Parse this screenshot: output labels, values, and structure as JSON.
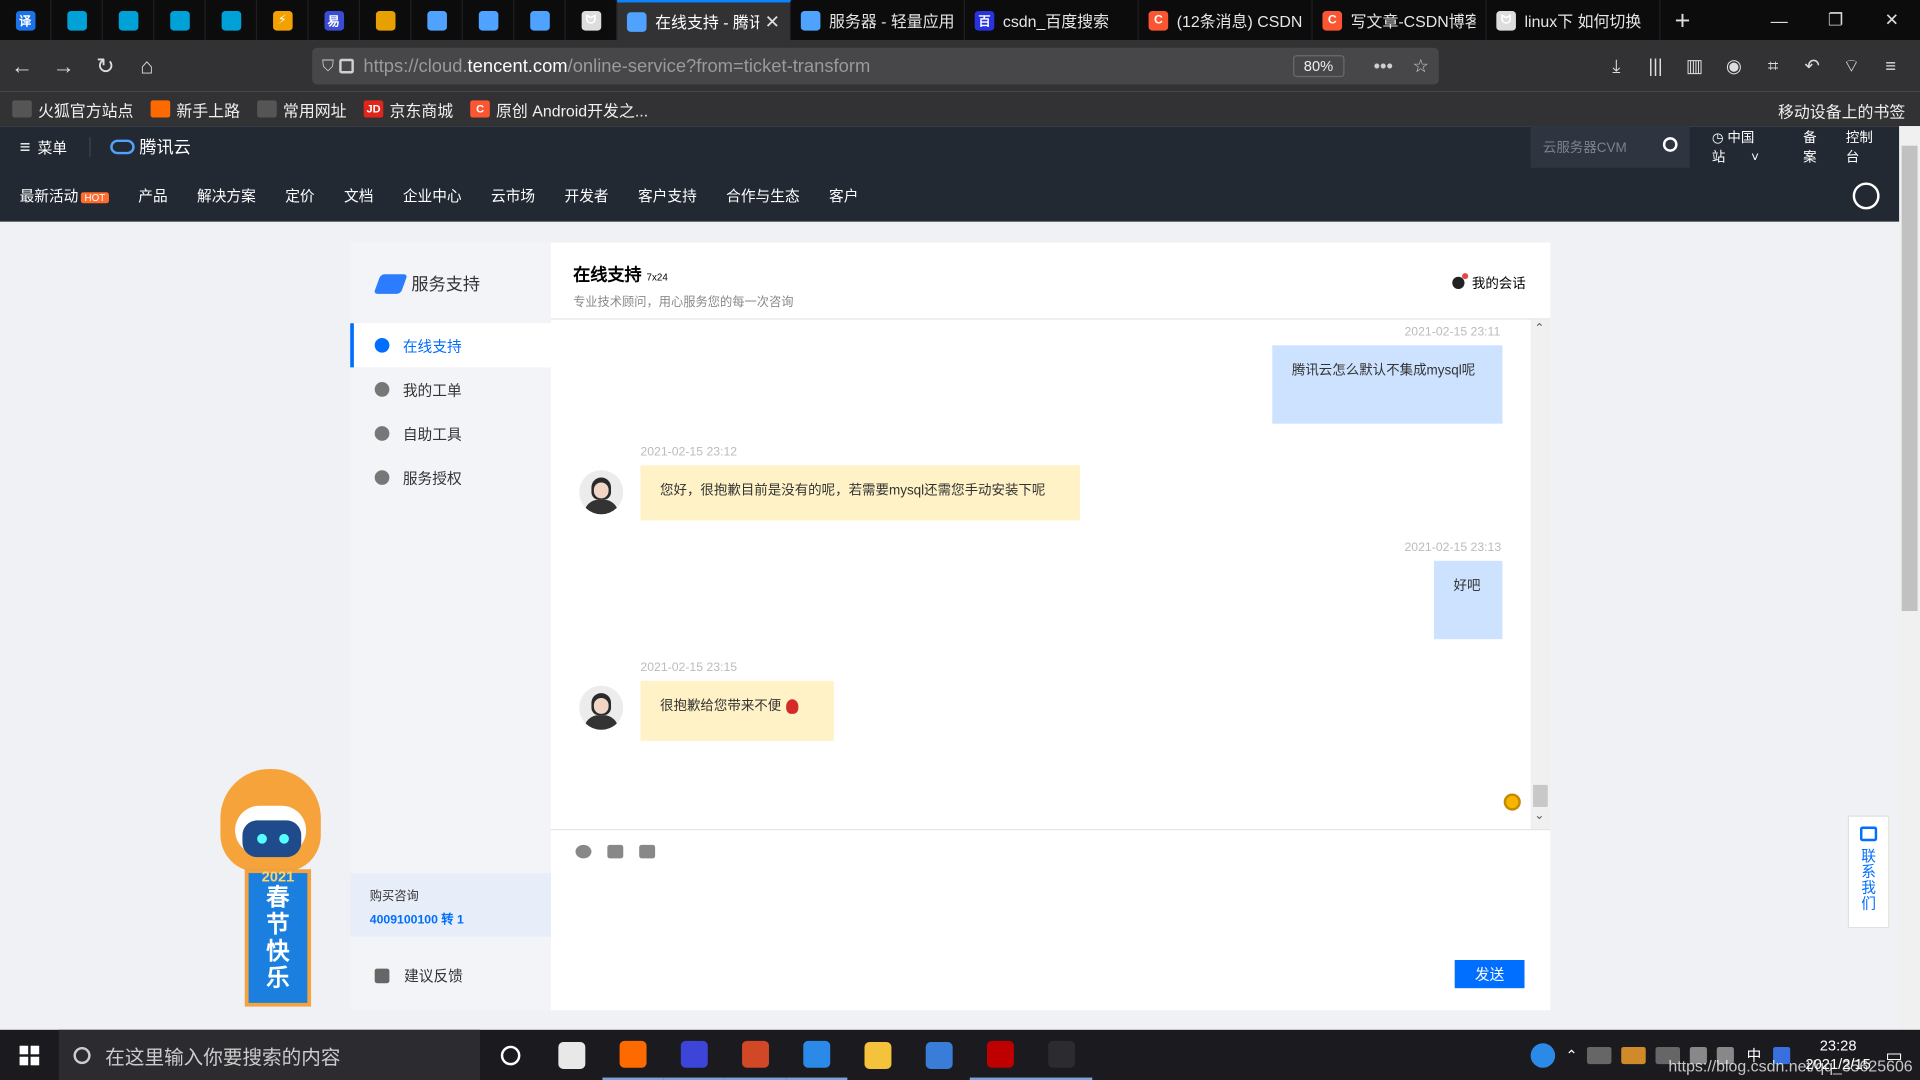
{
  "browser": {
    "tabs": [
      {
        "label": "",
        "icon": "translate-icon",
        "color": "#1a73e8",
        "pinned": true,
        "glyph": "译"
      },
      {
        "label": "",
        "icon": "bilibili-icon",
        "color": "#00a1d6",
        "pinned": true,
        "glyph": ""
      },
      {
        "label": "",
        "icon": "bilibili-icon",
        "color": "#00a1d6",
        "pinned": true,
        "glyph": ""
      },
      {
        "label": "",
        "icon": "bilibili-icon",
        "color": "#00a1d6",
        "pinned": true,
        "glyph": ""
      },
      {
        "label": "",
        "icon": "bilibili-icon",
        "color": "#00a1d6",
        "pinned": true,
        "glyph": ""
      },
      {
        "label": "",
        "icon": "lightning-icon",
        "color": "#f2a100",
        "pinned": true,
        "glyph": "⚡"
      },
      {
        "label": "",
        "icon": "app-icon",
        "color": "#3a4bd8",
        "pinned": true,
        "glyph": "易"
      },
      {
        "label": "",
        "icon": "box-icon",
        "color": "#e6a100",
        "pinned": true,
        "glyph": ""
      },
      {
        "label": "",
        "icon": "tencent-cloud-icon",
        "color": "#4fa3ff",
        "pinned": true,
        "glyph": ""
      },
      {
        "label": "",
        "icon": "tencent-cloud-icon",
        "color": "#4fa3ff",
        "pinned": true,
        "glyph": ""
      },
      {
        "label": "",
        "icon": "tencent-cloud-icon",
        "color": "#4fa3ff",
        "pinned": true,
        "glyph": ""
      },
      {
        "label": "",
        "icon": "wolf-icon",
        "color": "#dddddd",
        "pinned": true,
        "glyph": "ᗢ"
      },
      {
        "label": "在线支持 - 腾讯",
        "icon": "tencent-cloud-icon",
        "color": "#4fa3ff",
        "pinned": false,
        "active": true,
        "glyph": ""
      },
      {
        "label": "服务器 - 轻量应用",
        "icon": "tencent-cloud-icon",
        "color": "#4fa3ff",
        "pinned": false,
        "glyph": ""
      },
      {
        "label": "csdn_百度搜索",
        "icon": "baidu-icon",
        "color": "#2932e1",
        "pinned": false,
        "glyph": "百"
      },
      {
        "label": "(12条消息) CSDN",
        "icon": "csdn-icon",
        "color": "#fc5531",
        "pinned": false,
        "glyph": "C"
      },
      {
        "label": "写文章-CSDN博客",
        "icon": "csdn-icon",
        "color": "#fc5531",
        "pinned": false,
        "glyph": "C"
      },
      {
        "label": "linux下 如何切换",
        "icon": "wolf-icon",
        "color": "#dddddd",
        "pinned": false,
        "glyph": "ᗢ"
      }
    ],
    "new_tab": "+",
    "window_controls": [
      "—",
      "❐",
      "✕"
    ],
    "url_prefix": "https://cloud.",
    "url_domain": "tencent.com",
    "url_path": "/online-service?from=ticket-transform",
    "zoom": "80%",
    "bookmarks": [
      {
        "label": "火狐官方站点",
        "icon": "folder-icon",
        "color": "#555555",
        "glyph": ""
      },
      {
        "label": "新手上路",
        "icon": "firefox-icon",
        "color": "#ff6a00",
        "glyph": ""
      },
      {
        "label": "常用网址",
        "icon": "folder-icon",
        "color": "#555555",
        "glyph": ""
      },
      {
        "label": "京东商城",
        "icon": "jd-icon",
        "color": "#e1251b",
        "glyph": "JD"
      },
      {
        "label": "原创 Android开发之...",
        "icon": "csdn-icon",
        "color": "#fc5531",
        "glyph": "C"
      }
    ],
    "mobile_bookmarks": "移动设备上的书签"
  },
  "site": {
    "menu_label": "菜单",
    "brand": "腾讯云",
    "search_placeholder": "云服务器CVM",
    "region": "中国站",
    "beian": "备案",
    "console": "控制台",
    "nav": [
      "最新活动",
      "产品",
      "解决方案",
      "定价",
      "文档",
      "企业中心",
      "云市场",
      "开发者",
      "客户支持",
      "合作与生态",
      "客户"
    ],
    "hot_badge": "HOT"
  },
  "sidebar": {
    "title": "服务支持",
    "items": [
      {
        "label": "在线支持",
        "active": true
      },
      {
        "label": "我的工单"
      },
      {
        "label": "自助工具"
      },
      {
        "label": "服务授权"
      }
    ],
    "purchase_label": "购买咨询",
    "purchase_phone": "4009100100 转 1",
    "feedback": "建议反馈"
  },
  "chat": {
    "title": "在线支持",
    "title_badge": "7x24",
    "subtitle": "专业技术顾问，用心服务您的每一次咨询",
    "my_sessions": "我的会话",
    "messages": [
      {
        "from": "me",
        "time": "2021-02-15 23:11",
        "text": "腾讯云怎么默认不集成mysql呢"
      },
      {
        "from": "cs",
        "time": "2021-02-15 23:12",
        "text": "您好，很抱歉目前是没有的呢，若需要mysql还需您手动安装下呢"
      },
      {
        "from": "me",
        "time": "2021-02-15 23:13",
        "text": "好吧"
      },
      {
        "from": "cs",
        "time": "2021-02-15 23:15",
        "text": "很抱歉给您带来不便"
      }
    ],
    "send": "发送"
  },
  "mascot": {
    "year": "2021",
    "chars": [
      "春",
      "节",
      "快",
      "乐"
    ]
  },
  "contact_us": [
    "联",
    "系",
    "我",
    "们"
  ],
  "taskbar": {
    "search_placeholder": "在这里输入你要搜索的内容",
    "apps": [
      {
        "icon": "cortana-icon",
        "color": "#1b1b1f"
      },
      {
        "icon": "typora-icon",
        "color": "#e8e8e8"
      },
      {
        "icon": "firefox-icon",
        "color": "#ff6a00",
        "open": true
      },
      {
        "icon": "intellij-icon",
        "color": "#3d44d8",
        "open": true
      },
      {
        "icon": "powerpoint-icon",
        "color": "#d24726",
        "open": true
      },
      {
        "icon": "xftp-icon",
        "color": "#2b8ae8",
        "open": true
      },
      {
        "icon": "file-explorer-icon",
        "color": "#f4c23b"
      },
      {
        "icon": "app-icon",
        "color": "#3a7dd8"
      },
      {
        "icon": "filezilla-icon",
        "color": "#bf0000",
        "open": true
      },
      {
        "icon": "camera-icon",
        "color": "#2b2b30",
        "open": true
      }
    ],
    "time": "23:28",
    "date": "2021/2/15",
    "ime": "中",
    "watermark": "https://blog.csdn.net/qq_35625606"
  }
}
